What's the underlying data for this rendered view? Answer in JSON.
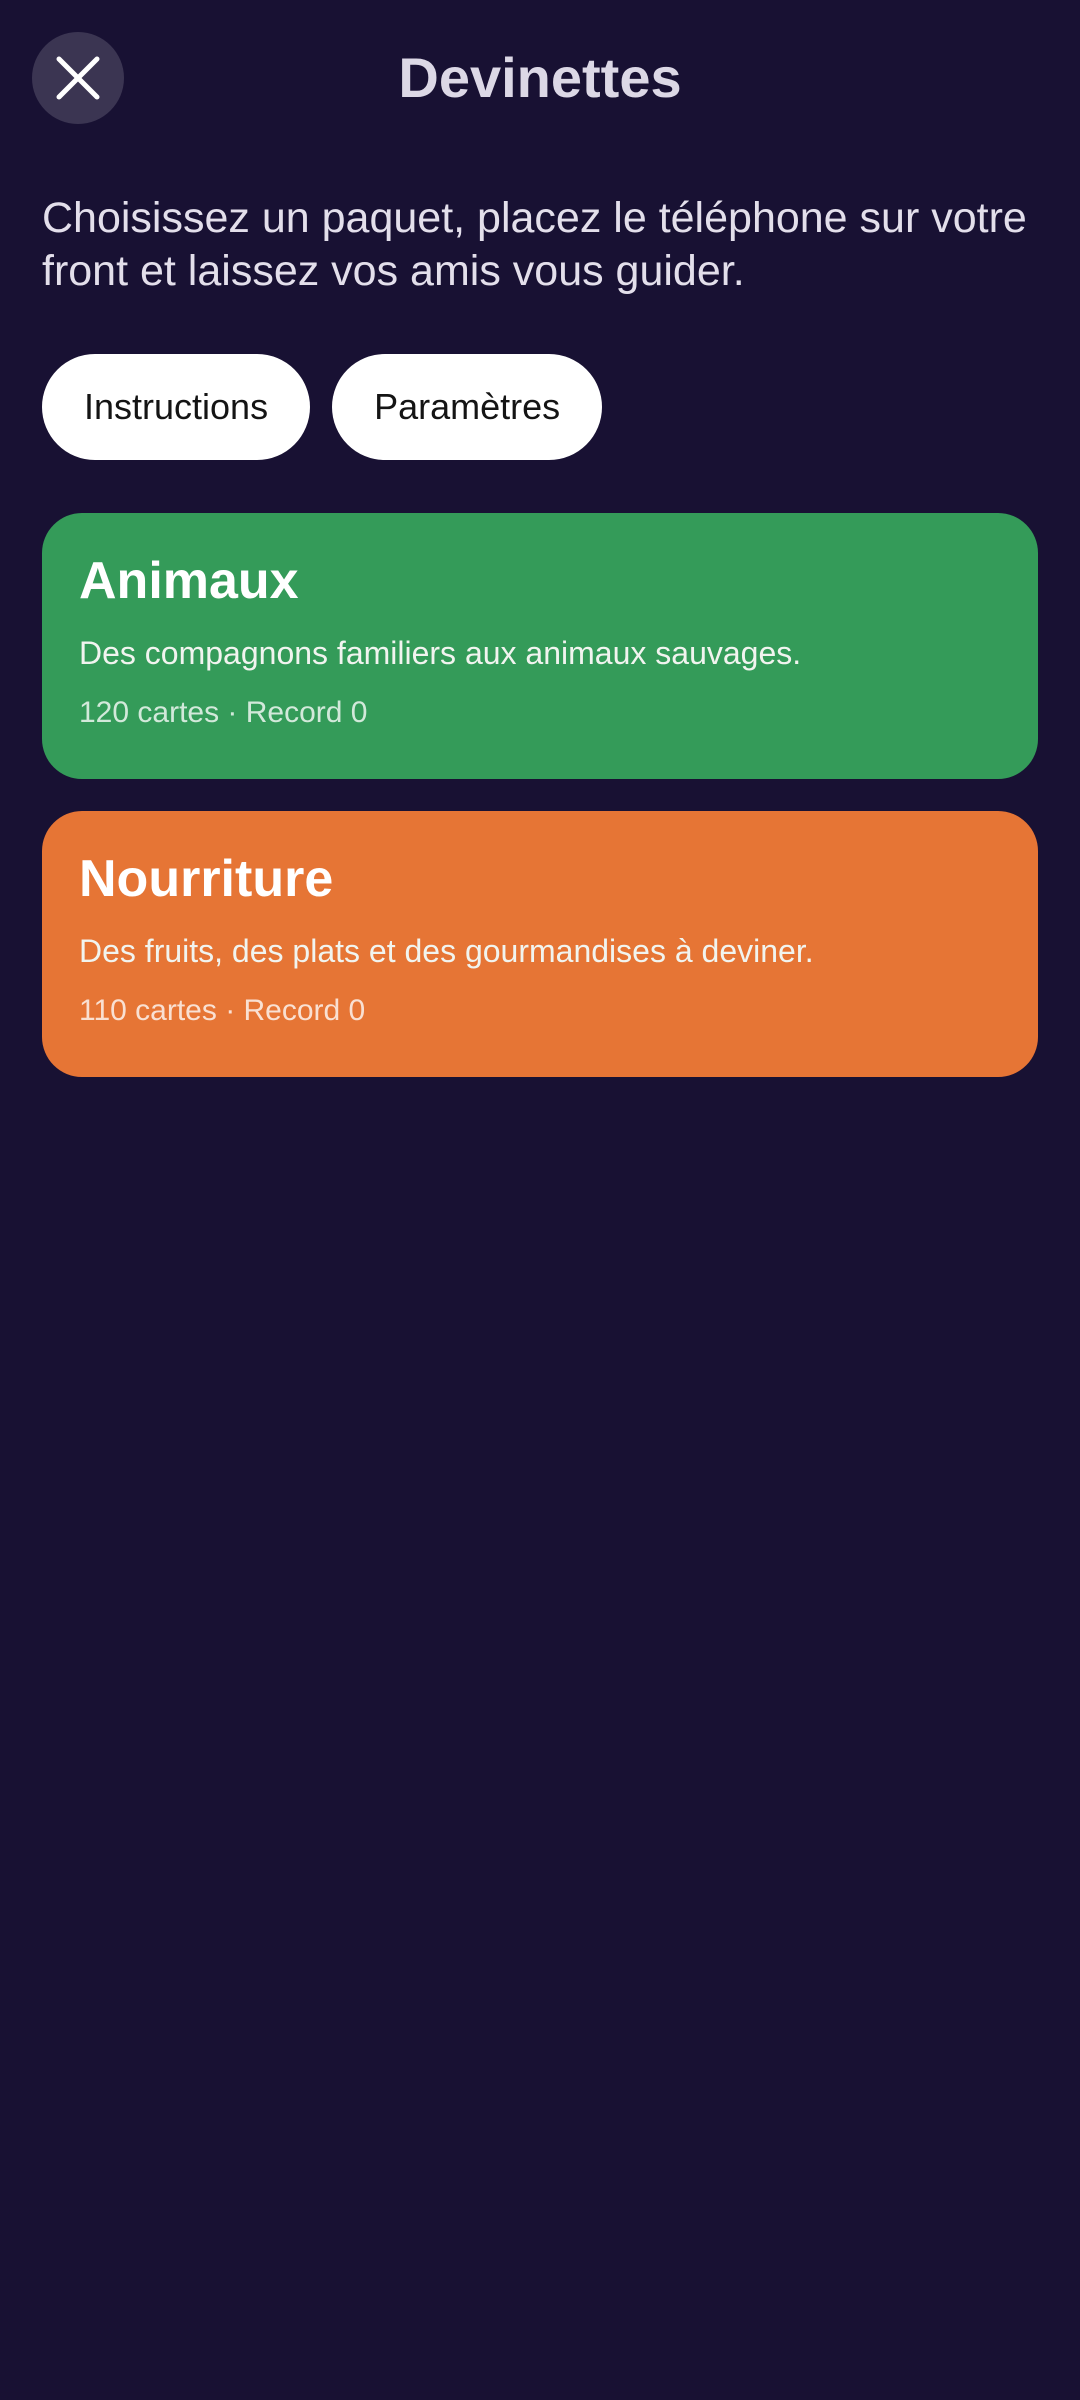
{
  "header": {
    "title": "Devinettes",
    "close_icon": "close-icon"
  },
  "intro": "Choisissez un paquet, placez le téléphone sur votre front et laissez vos amis vous guider.",
  "actions": [
    {
      "label": "Instructions"
    },
    {
      "label": "Paramètres"
    }
  ],
  "decks": [
    {
      "title": "Animaux",
      "description": "Des compagnons familiers aux animaux sauvages.",
      "meta": "120 cartes · Record 0",
      "color": "#349b59"
    },
    {
      "title": "Nourriture",
      "description": "Des fruits, des plats et des gourmandises à deviner.",
      "meta": "110 cartes · Record 0",
      "color": "#e67535"
    }
  ],
  "colors": {
    "background": "#181133",
    "close_button_bg": "#3b3552",
    "chip_bg": "#ffffff"
  }
}
